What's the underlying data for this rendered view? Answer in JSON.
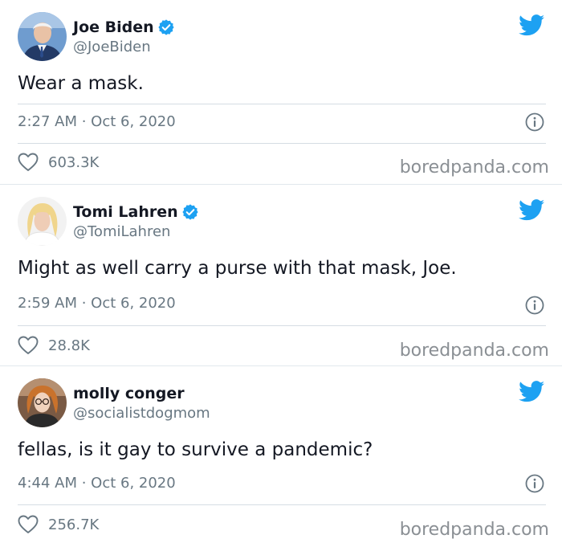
{
  "watermark": "boredpanda.com",
  "colors": {
    "twitter_blue": "#1da1f2",
    "text_primary": "#141823",
    "text_secondary": "#687782",
    "divider": "#e1e8ed"
  },
  "tweets": [
    {
      "display_name": "Joe Biden",
      "verified": true,
      "handle": "@JoeBiden",
      "text": "Wear a mask.",
      "timestamp": "2:27 AM · Oct 6, 2020",
      "likes": "603.3K",
      "avatar_icon": "avatar-joe-biden"
    },
    {
      "display_name": "Tomi Lahren",
      "verified": true,
      "handle": "@TomiLahren",
      "text": "Might as well carry a purse with that mask, Joe.",
      "timestamp": "2:59 AM · Oct 6, 2020",
      "likes": "28.8K",
      "avatar_icon": "avatar-tomi-lahren"
    },
    {
      "display_name": "molly conger",
      "verified": false,
      "handle": "@socialistdogmom",
      "text": "fellas, is it gay to survive a pandemic?",
      "timestamp": "4:44 AM · Oct 6, 2020",
      "likes": "256.7K",
      "avatar_icon": "avatar-molly-conger"
    }
  ]
}
